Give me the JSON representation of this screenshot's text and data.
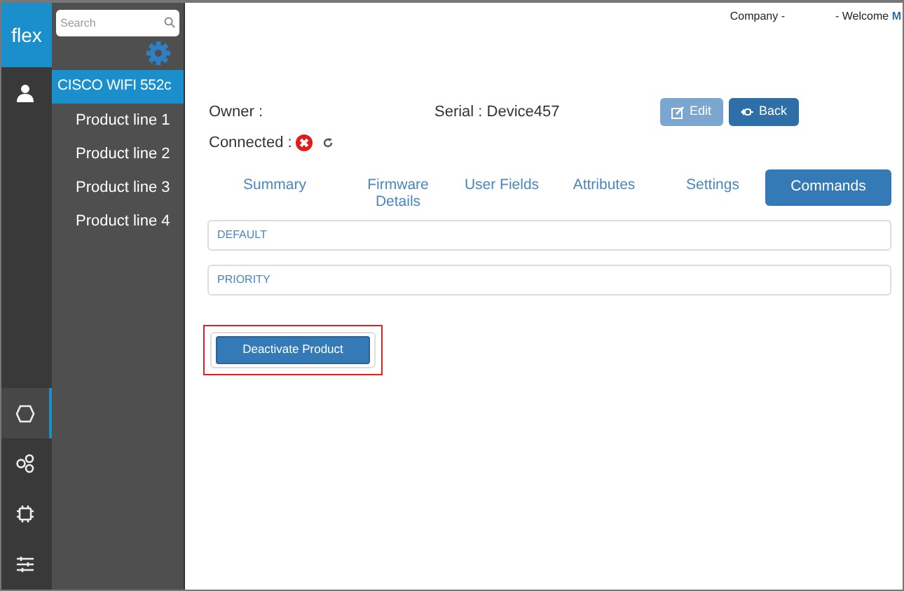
{
  "rail": {
    "logo": "flex",
    "items": [
      {
        "kind": "user",
        "selected": false
      },
      {
        "kind": "hexagon",
        "selected": true
      },
      {
        "kind": "circles",
        "selected": false
      },
      {
        "kind": "chip",
        "selected": false
      },
      {
        "kind": "sliders",
        "selected": false
      }
    ]
  },
  "sidebar": {
    "search": {
      "placeholder": "Search"
    },
    "items": [
      {
        "label": "CISCO WIFI 552c",
        "selected": true
      },
      {
        "label": "Product line 1",
        "selected": false
      },
      {
        "label": "Product line 2",
        "selected": false
      },
      {
        "label": "Product line 3",
        "selected": false
      },
      {
        "label": "Product line 4",
        "selected": false
      }
    ]
  },
  "header": {
    "company": "Company -",
    "welcome": "- Welcome **M**"
  },
  "device": {
    "owner": "Owner :",
    "serial": "Serial : Device457",
    "connected_label": "Connected :",
    "connected": false
  },
  "buttons": [
    {
      "label": "Edit",
      "kind": "edit",
      "disabled": true
    },
    {
      "label": "Back",
      "kind": "back",
      "disabled": false
    }
  ],
  "tabs": [
    {
      "label": "Summary",
      "selected": false
    },
    {
      "label": "Firmware Details",
      "selected": false
    },
    {
      "label": "User Fields",
      "selected": false
    },
    {
      "label": "Attributes",
      "selected": false
    },
    {
      "label": "Settings",
      "selected": false
    },
    {
      "label": "Commands",
      "selected": true
    }
  ],
  "panels": [
    "DEFAULT",
    "PRIORITY"
  ],
  "action": {
    "label": "Deactivate Product",
    "highlighted": true
  }
}
